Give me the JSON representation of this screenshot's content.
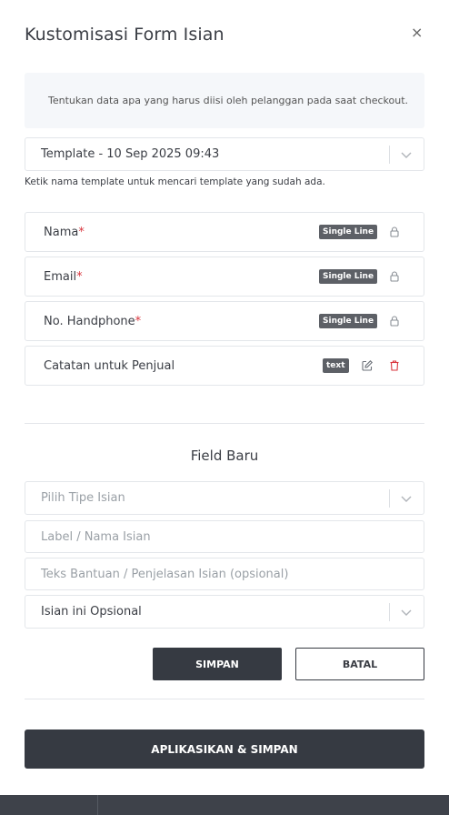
{
  "modal": {
    "title": "Kustomisasi Form Isian",
    "close_label": "×",
    "info_text": "Tentukan data apa yang harus diisi oleh pelanggan pada saat checkout.",
    "template_select_value": "Template - 10 Sep 2025 09:43",
    "template_hint": "Ketik nama template untuk mencari template yang sudah ada.",
    "fields": [
      {
        "label": "Nama",
        "required": "*",
        "type": "Single Line"
      },
      {
        "label": "Email",
        "required": "*",
        "type": "Single Line"
      },
      {
        "label": "No. Handphone",
        "required": "*",
        "type": "Single Line"
      },
      {
        "label": "Catatan untuk Penjual",
        "required": "",
        "type": "text"
      }
    ]
  },
  "new_field": {
    "title": "Field Baru",
    "type_placeholder": "Pilih Tipe Isian",
    "label_placeholder": "Label / Nama Isian",
    "help_placeholder": "Teks Bantuan / Penjelasan Isian (opsional)",
    "optional_value": "Isian ini Opsional",
    "save_label": "SIMPAN",
    "cancel_label": "BATAL"
  },
  "apply_label": "APLIKASIKAN & SIMPAN",
  "colors": {
    "dark": "#363a42",
    "required": "#d9363e",
    "delete": "#d9363e",
    "badge": "#5d6066"
  }
}
